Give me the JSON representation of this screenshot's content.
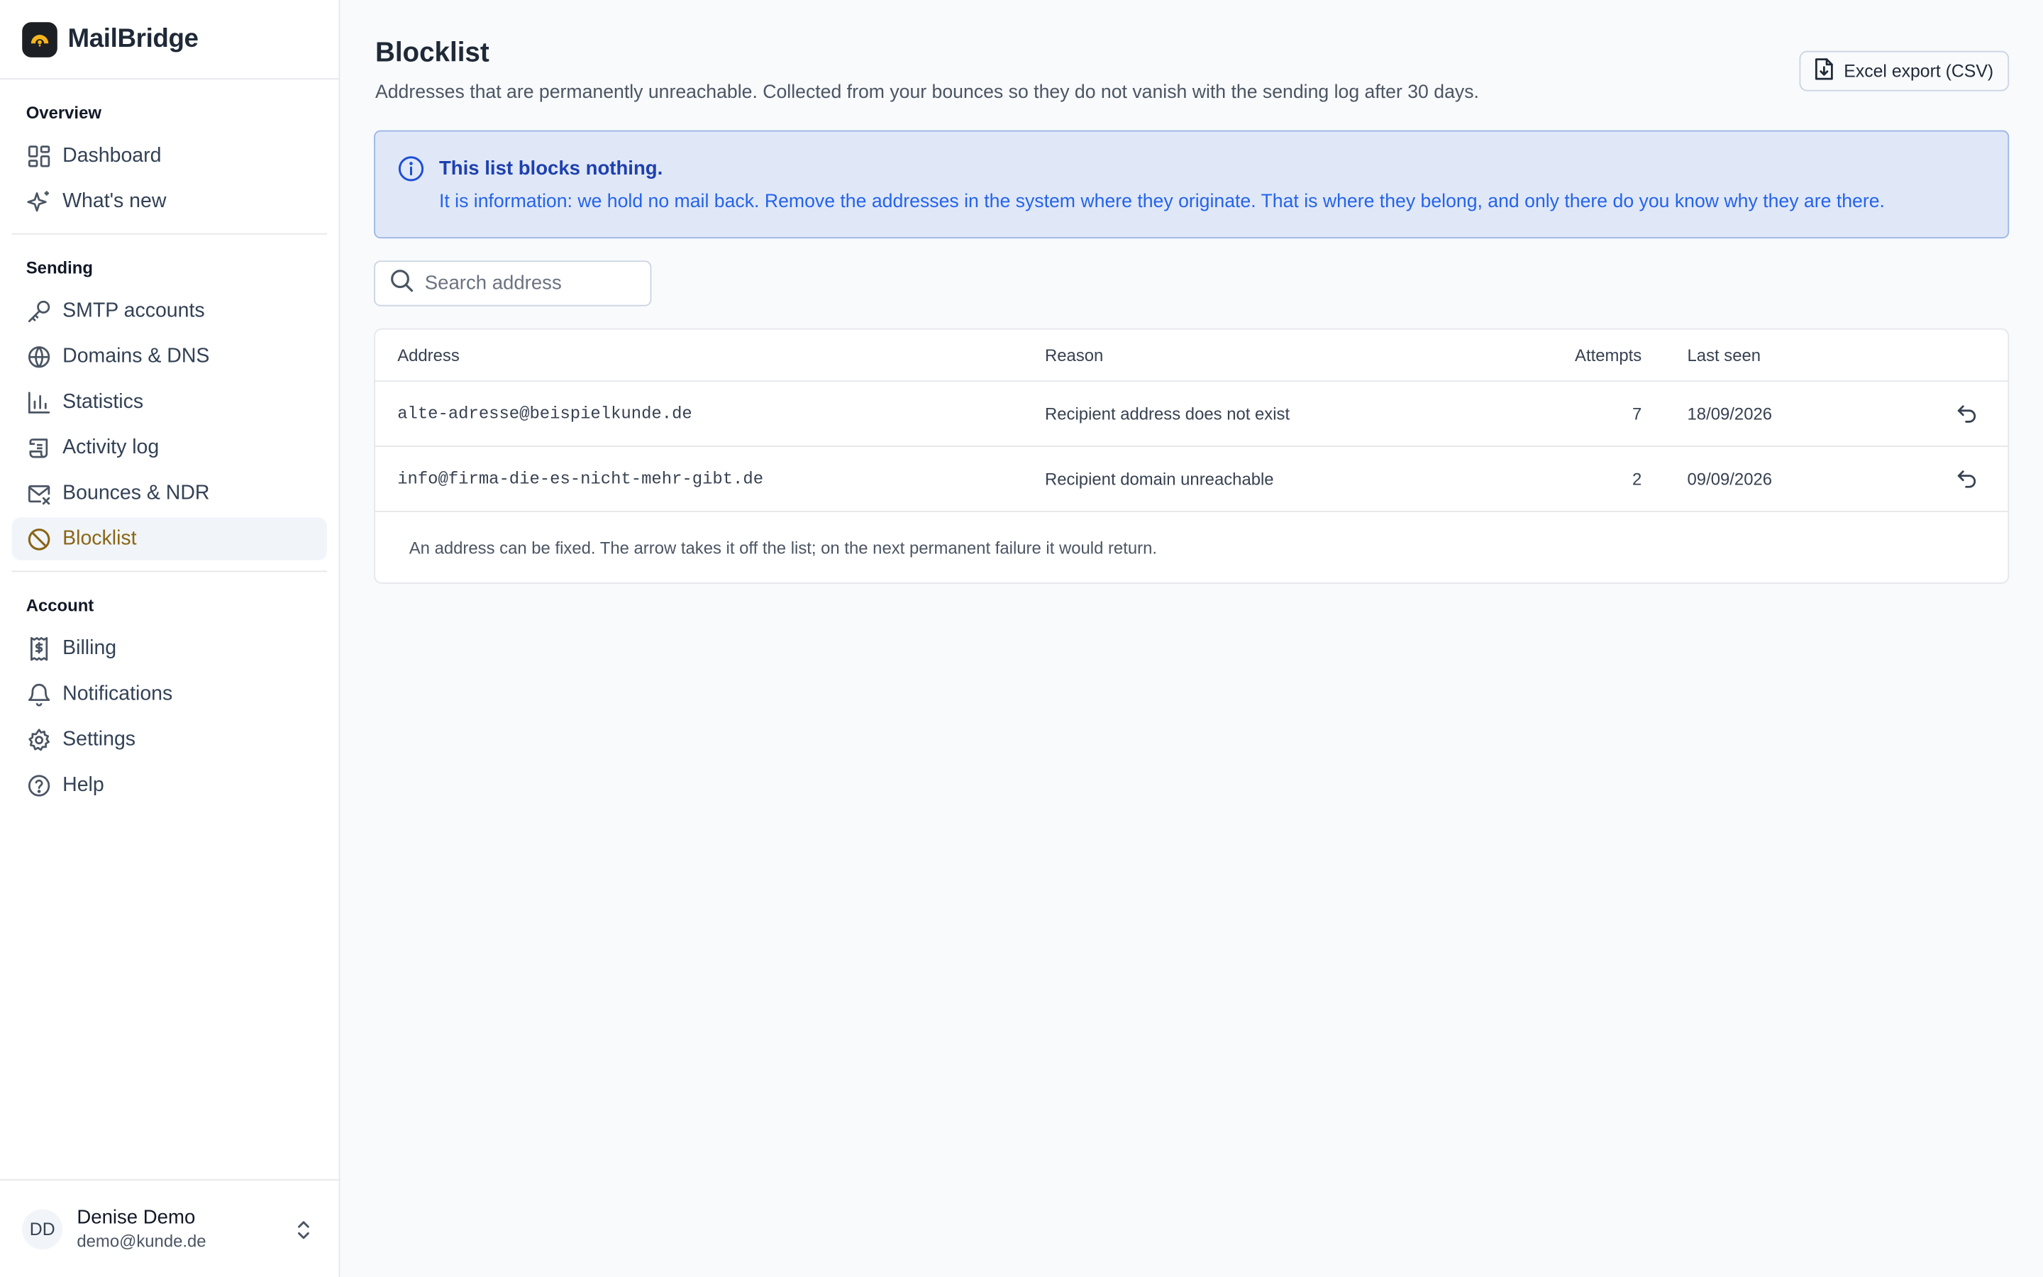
{
  "app": {
    "name": "MailBridge"
  },
  "nav": {
    "sections": [
      {
        "label": "Overview",
        "items": [
          {
            "label": "Dashboard",
            "icon": "dashboard-icon"
          },
          {
            "label": "What's new",
            "icon": "sparkles-icon"
          }
        ]
      },
      {
        "label": "Sending",
        "items": [
          {
            "label": "SMTP accounts",
            "icon": "key-icon"
          },
          {
            "label": "Domains & DNS",
            "icon": "globe-icon"
          },
          {
            "label": "Statistics",
            "icon": "bar-chart-icon"
          },
          {
            "label": "Activity log",
            "icon": "scroll-icon"
          },
          {
            "label": "Bounces & NDR",
            "icon": "mail-x-icon"
          },
          {
            "label": "Blocklist",
            "icon": "ban-icon",
            "active": true
          }
        ]
      },
      {
        "label": "Account",
        "items": [
          {
            "label": "Billing",
            "icon": "receipt-icon"
          },
          {
            "label": "Notifications",
            "icon": "bell-icon"
          },
          {
            "label": "Settings",
            "icon": "gear-icon"
          },
          {
            "label": "Help",
            "icon": "help-circle-icon"
          }
        ]
      }
    ]
  },
  "user": {
    "initials": "DD",
    "name": "Denise Demo",
    "email": "demo@kunde.de"
  },
  "page": {
    "title": "Blocklist",
    "subtitle": "Addresses that are permanently unreachable. Collected from your bounces so they do not vanish with the sending log after 30 days.",
    "export_label": "Excel export (CSV)"
  },
  "info": {
    "title": "This list blocks nothing.",
    "text": "It is information: we hold no mail back. Remove the addresses in the system where they originate. That is where they belong, and only there do you know why they are there."
  },
  "search": {
    "placeholder": "Search address"
  },
  "table": {
    "headers": {
      "address": "Address",
      "reason": "Reason",
      "attempts": "Attempts",
      "last_seen": "Last seen"
    },
    "rows": [
      {
        "address": "alte-adresse@beispielkunde.de",
        "reason": "Recipient address does not exist",
        "attempts": "7",
        "last_seen": "18/09/2026"
      },
      {
        "address": "info@firma-die-es-nicht-mehr-gibt.de",
        "reason": "Recipient domain unreachable",
        "attempts": "2",
        "last_seen": "09/09/2026"
      }
    ],
    "footer": "An address can be fixed. The arrow takes it off the list; on the next permanent failure it would return."
  },
  "colors": {
    "accent": "#8a6516",
    "info_bg": "#e0e8f7",
    "info_border": "#9cb6e6",
    "info_text": "#2563eb"
  }
}
